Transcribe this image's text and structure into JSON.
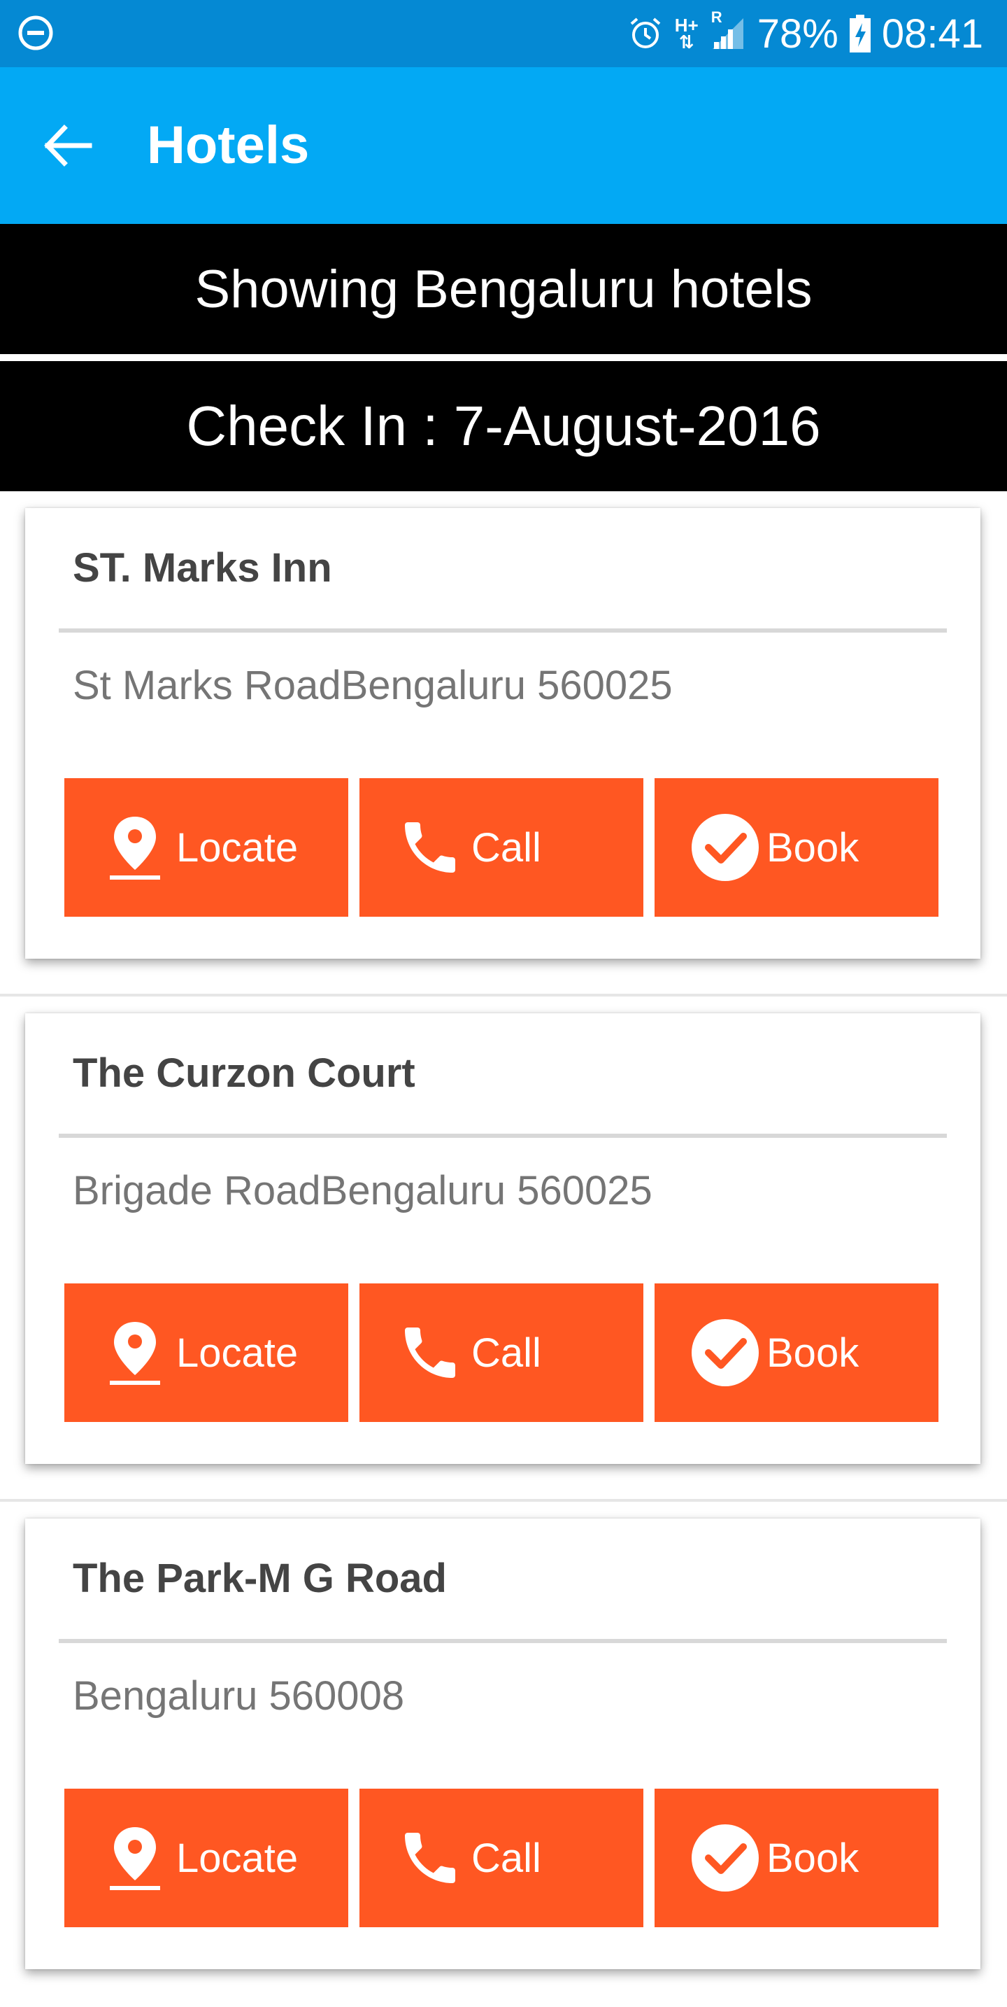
{
  "status_bar": {
    "battery": "78%",
    "time": "08:41",
    "network": "H+",
    "roaming": "R",
    "icons": [
      "do-not-disturb-icon",
      "alarm-icon",
      "data-arrows-icon",
      "signal-icon",
      "battery-charging-icon"
    ]
  },
  "app_bar": {
    "title": "Hotels",
    "back_icon": "arrow-back-icon"
  },
  "banners": {
    "city": "Showing Bengaluru hotels",
    "checkin": "Check In : 7-August-2016"
  },
  "hotels": [
    {
      "name": "ST. Marks Inn",
      "address": "St Marks RoadBengaluru 560025",
      "locate_label": "Locate",
      "call_label": "Call",
      "book_label": "Book"
    },
    {
      "name": "The Curzon Court",
      "address": "Brigade RoadBengaluru 560025",
      "locate_label": "Locate",
      "call_label": "Call",
      "book_label": "Book"
    },
    {
      "name": "The Park-M G Road",
      "address": "Bengaluru 560008",
      "locate_label": "Locate",
      "call_label": "Call",
      "book_label": "Book"
    }
  ],
  "colors": {
    "status_bar": "#0589d3",
    "app_bar": "#03a9f4",
    "banner": "#000000",
    "button": "#ff5722",
    "hotel_name": "#444444",
    "address": "#757575"
  }
}
